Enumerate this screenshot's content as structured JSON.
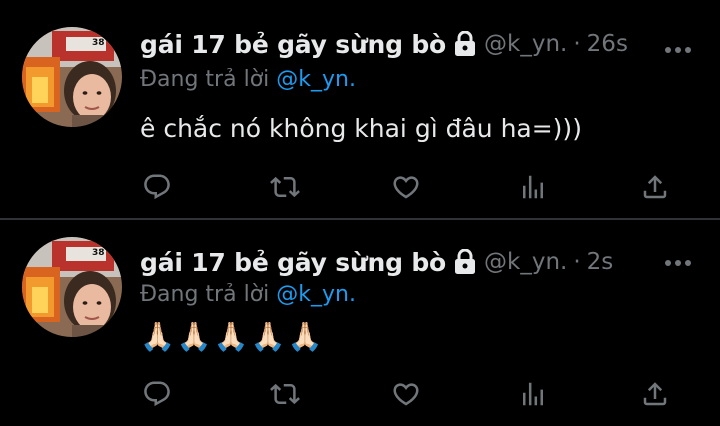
{
  "tweets": [
    {
      "display_name": "gái 17 bẻ gãy sừng bò",
      "handle": "@k_yn.",
      "separator": "·",
      "time": "26s",
      "reply_prefix": "Đang trả lời",
      "reply_to": "@k_yn.",
      "text": "ê chắc nó không khai gì đâu ha=)))",
      "avatar_fire_truck_number": "38"
    },
    {
      "display_name": "gái 17 bẻ gãy sừng bò",
      "handle": "@k_yn.",
      "separator": "·",
      "time": "2s",
      "reply_prefix": "Đang trả lời",
      "reply_to": "@k_yn.",
      "text": "🙏🏻🙏🏻🙏🏻🙏🏻🙏🏻",
      "avatar_fire_truck_number": "38"
    }
  ],
  "icons": {
    "lock": "lock-icon",
    "more": "more-icon",
    "reply": "reply-icon",
    "retweet": "retweet-icon",
    "like": "heart-icon",
    "views": "views-icon",
    "share": "share-icon"
  },
  "colors": {
    "background": "#000000",
    "text_primary": "#e7e9ea",
    "text_secondary": "#71767b",
    "link": "#1d9bf0",
    "divider": "#2f3336"
  }
}
